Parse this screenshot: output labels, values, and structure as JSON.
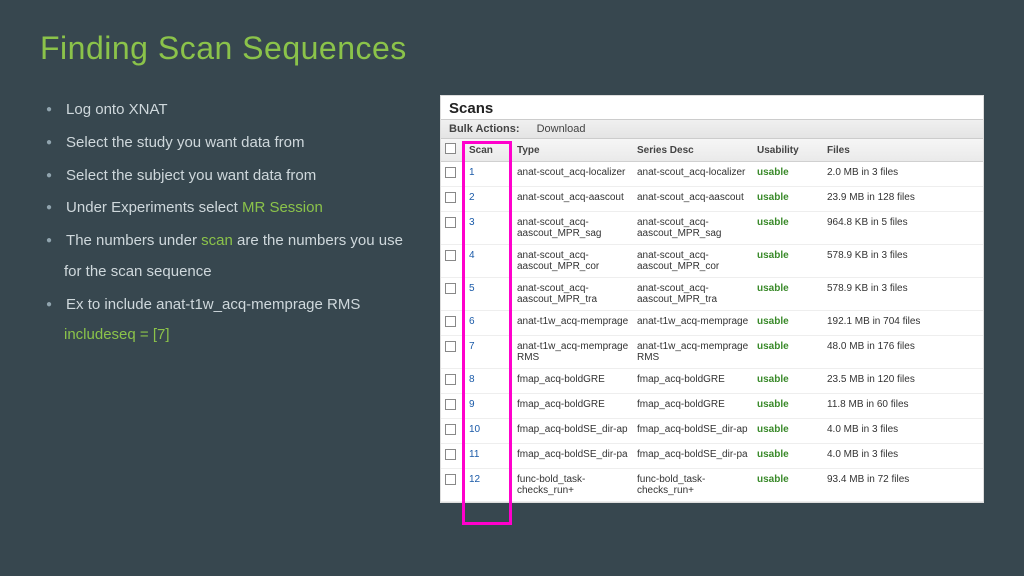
{
  "title": "Finding Scan Sequences",
  "bullets": [
    {
      "pre": "Log onto XNAT"
    },
    {
      "pre": "Select the study you want data from"
    },
    {
      "pre": "Select the subject you want data from"
    },
    {
      "pre": "Under Experiments select ",
      "hl": "MR Session"
    },
    {
      "pre": "The numbers under ",
      "hl": "scan",
      "post": " are the numbers you use for the scan sequence"
    },
    {
      "pre": "Ex to include anat-t1w_acq-memprage RMS ",
      "hl": "includeseq = [7]"
    }
  ],
  "panel": {
    "heading": "Scans",
    "bulk_label": "Bulk Actions:",
    "bulk_action": "Download"
  },
  "columns": [
    "",
    "Scan",
    "Type",
    "Series Desc",
    "Usability",
    "Files"
  ],
  "rows": [
    {
      "n": "1",
      "type": "anat-scout_acq-localizer",
      "desc": "anat-scout_acq-localizer",
      "u": "usable",
      "f": "2.0 MB in 3 files"
    },
    {
      "n": "2",
      "type": "anat-scout_acq-aascout",
      "desc": "anat-scout_acq-aascout",
      "u": "usable",
      "f": "23.9 MB in 128 files"
    },
    {
      "n": "3",
      "type": "anat-scout_acq-aascout_MPR_sag",
      "desc": "anat-scout_acq-aascout_MPR_sag",
      "u": "usable",
      "f": "964.8 KB in 5 files"
    },
    {
      "n": "4",
      "type": "anat-scout_acq-aascout_MPR_cor",
      "desc": "anat-scout_acq-aascout_MPR_cor",
      "u": "usable",
      "f": "578.9 KB in 3 files"
    },
    {
      "n": "5",
      "type": "anat-scout_acq-aascout_MPR_tra",
      "desc": "anat-scout_acq-aascout_MPR_tra",
      "u": "usable",
      "f": "578.9 KB in 3 files"
    },
    {
      "n": "6",
      "type": "anat-t1w_acq-memprage",
      "desc": "anat-t1w_acq-memprage",
      "u": "usable",
      "f": "192.1 MB in 704 files"
    },
    {
      "n": "7",
      "type": "anat-t1w_acq-memprage RMS",
      "desc": "anat-t1w_acq-memprage RMS",
      "u": "usable",
      "f": "48.0 MB in 176 files"
    },
    {
      "n": "8",
      "type": "fmap_acq-boldGRE",
      "desc": "fmap_acq-boldGRE",
      "u": "usable",
      "f": "23.5 MB in 120 files"
    },
    {
      "n": "9",
      "type": "fmap_acq-boldGRE",
      "desc": "fmap_acq-boldGRE",
      "u": "usable",
      "f": "11.8 MB in 60 files"
    },
    {
      "n": "10",
      "type": "fmap_acq-boldSE_dir-ap",
      "desc": "fmap_acq-boldSE_dir-ap",
      "u": "usable",
      "f": "4.0 MB in 3 files"
    },
    {
      "n": "11",
      "type": "fmap_acq-boldSE_dir-pa",
      "desc": "fmap_acq-boldSE_dir-pa",
      "u": "usable",
      "f": "4.0 MB in 3 files"
    },
    {
      "n": "12",
      "type": "func-bold_task-checks_run+",
      "desc": "func-bold_task-checks_run+",
      "u": "usable",
      "f": "93.4 MB in 72 files"
    }
  ]
}
